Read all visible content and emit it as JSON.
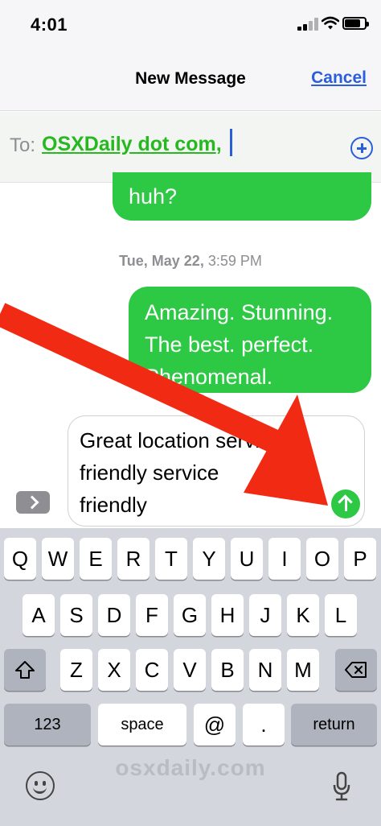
{
  "status_bar": {
    "time": "4:01",
    "battery_level": 0.8
  },
  "nav": {
    "title": "New Message",
    "cancel_label": "Cancel"
  },
  "compose": {
    "to_label": "To:",
    "recipient": "OSXDaily dot com",
    "separator": ","
  },
  "conversation": {
    "top_bubble_text": "huh?",
    "timestamp_day": "Tue, May 22,",
    "timestamp_time": "3:59 PM",
    "bubble_lines": [
      "Amazing. Stunning.",
      "The best. perfect.",
      "Phenomenal."
    ]
  },
  "input": {
    "lines": [
      "Great location services",
      "friendly service",
      "friendly"
    ]
  },
  "keyboard": {
    "row1": [
      "Q",
      "W",
      "E",
      "R",
      "T",
      "Y",
      "U",
      "I",
      "O",
      "P"
    ],
    "row2": [
      "A",
      "S",
      "D",
      "F",
      "G",
      "H",
      "J",
      "K",
      "L"
    ],
    "row3": [
      "Z",
      "X",
      "C",
      "V",
      "B",
      "N",
      "M"
    ],
    "numbers_label": "123",
    "space_label": "space",
    "at_label": "@",
    "dot_label": ".",
    "return_label": "return"
  },
  "watermark": "osxdaily.com",
  "colors": {
    "bubble_green": "#2dc844",
    "link_blue": "#2b5fd9",
    "arrow_red": "#f12a14",
    "recipient_green": "#26b81f"
  }
}
